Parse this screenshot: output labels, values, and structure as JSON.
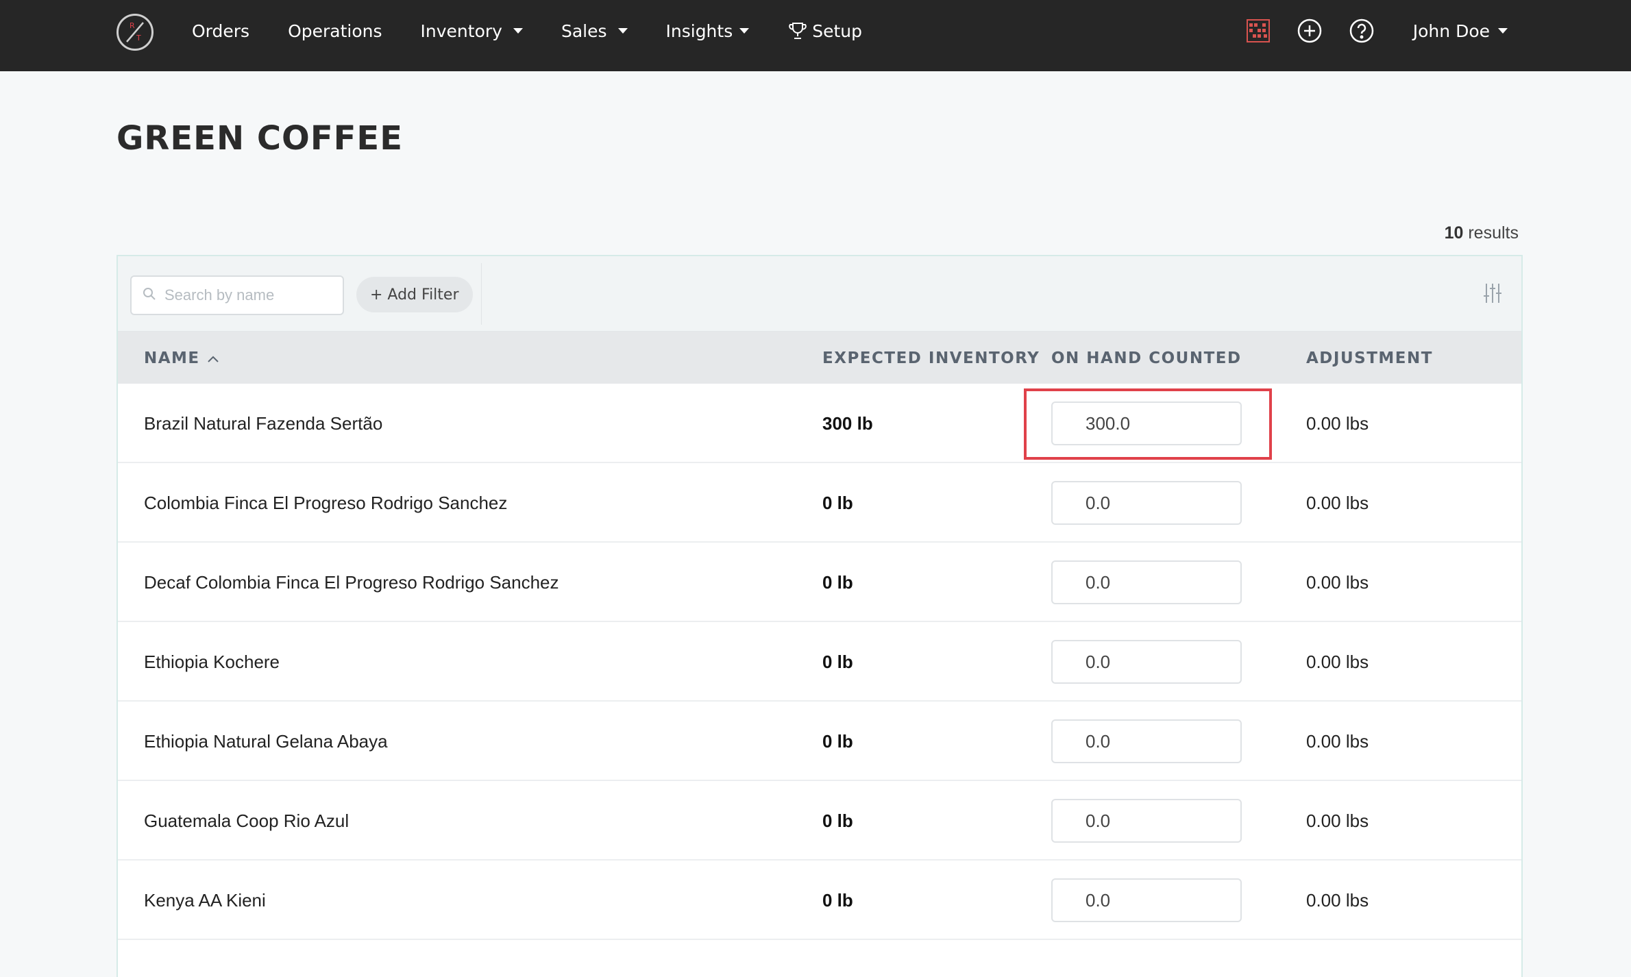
{
  "nav": {
    "items": [
      {
        "label": "Orders",
        "dropdown": false
      },
      {
        "label": "Operations",
        "dropdown": false
      },
      {
        "label": "Inventory",
        "dropdown": true
      },
      {
        "label": "Sales",
        "dropdown": true
      },
      {
        "label": "Insights",
        "dropdown": true
      },
      {
        "label": "Setup",
        "dropdown": false,
        "icon": "trophy-icon"
      }
    ],
    "right_icons": [
      "abacus-icon",
      "plus-circle-icon",
      "help-circle-icon"
    ],
    "user_name": "John Doe"
  },
  "page": {
    "title": "GREEN COFFEE",
    "results_count": "10",
    "results_label": "results"
  },
  "toolbar": {
    "search_placeholder": "Search by name",
    "add_filter_label": "+ Add Filter"
  },
  "table": {
    "columns": [
      "NAME",
      "EXPECTED INVENTORY",
      "ON HAND COUNTED",
      "ADJUSTMENT"
    ],
    "sorted_column": "NAME",
    "sort_direction": "ascending",
    "rows": [
      {
        "name": "Brazil Natural Fazenda Sertão",
        "expected": "300 lb",
        "on_hand": "300.0",
        "adjustment": "0.00 lbs"
      },
      {
        "name": "Colombia Finca El Progreso Rodrigo Sanchez",
        "expected": "0 lb",
        "on_hand": "0.0",
        "adjustment": "0.00 lbs"
      },
      {
        "name": "Decaf Colombia Finca El Progreso Rodrigo Sanchez",
        "expected": "0 lb",
        "on_hand": "0.0",
        "adjustment": "0.00 lbs"
      },
      {
        "name": "Ethiopia Kochere",
        "expected": "0 lb",
        "on_hand": "0.0",
        "adjustment": "0.00 lbs"
      },
      {
        "name": "Ethiopia Natural Gelana Abaya",
        "expected": "0 lb",
        "on_hand": "0.0",
        "adjustment": "0.00 lbs"
      },
      {
        "name": "Guatemala Coop Rio Azul",
        "expected": "0 lb",
        "on_hand": "0.0",
        "adjustment": "0.00 lbs"
      },
      {
        "name": "Kenya AA Kieni",
        "expected": "0 lb",
        "on_hand": "0.0",
        "adjustment": "0.00 lbs"
      }
    ]
  },
  "colors": {
    "navbar": "#262626",
    "highlight": "#e0414a",
    "abacus": "#d9534f"
  }
}
